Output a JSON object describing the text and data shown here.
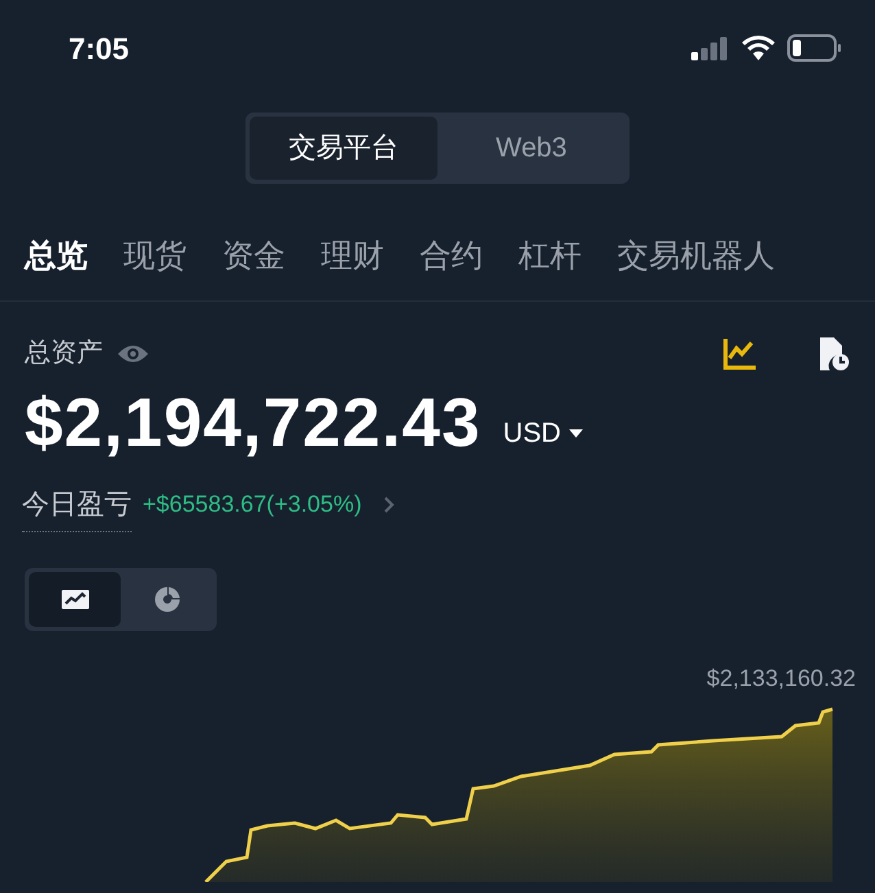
{
  "status_bar": {
    "time": "7:05"
  },
  "platform_switch": [
    {
      "label": "交易平台",
      "selected": true
    },
    {
      "label": "Web3",
      "selected": false
    }
  ],
  "tabs": [
    {
      "label": "总览",
      "selected": true
    },
    {
      "label": "现货",
      "selected": false
    },
    {
      "label": "资金",
      "selected": false
    },
    {
      "label": "理财",
      "selected": false
    },
    {
      "label": "合约",
      "selected": false
    },
    {
      "label": "杠杆",
      "selected": false
    },
    {
      "label": "交易机器人",
      "selected": false
    }
  ],
  "total_assets": {
    "label": "总资产",
    "amount": "$2,194,722.43",
    "currency": "USD"
  },
  "daily_pnl": {
    "label": "今日盈亏",
    "value": "+$65583.67(+3.05%)"
  },
  "chart_toggle": [
    {
      "kind": "line",
      "selected": true
    },
    {
      "kind": "pie",
      "selected": false
    }
  ],
  "chart": {
    "max_label": "$2,133,160.32"
  }
}
